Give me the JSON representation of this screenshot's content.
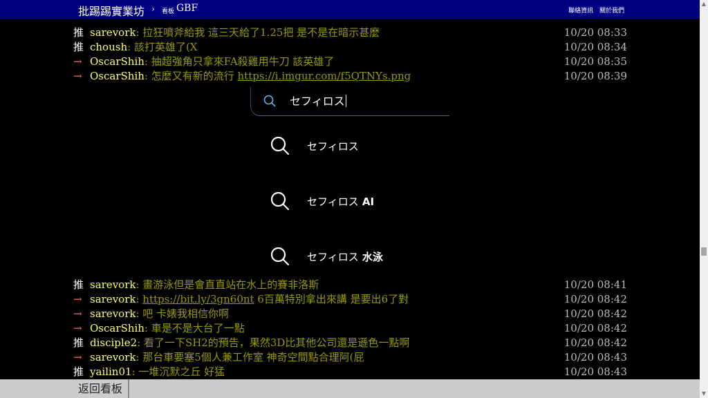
{
  "header": {
    "brand": "批踢踢實業坊",
    "separator": "›",
    "board_label": "看板",
    "board_name": "GBF",
    "links": [
      "聯絡資訊",
      "關於我們"
    ]
  },
  "pushes_top": [
    {
      "tag": "推",
      "user": "sarevork",
      "content": ": 拉狂噴斧給我 這三天給了1.25把 是不是在暗示甚麼",
      "ipdatetime": "10/20 08:33"
    },
    {
      "tag": "推",
      "user": "choush",
      "content": ": 該打英雄了(X",
      "ipdatetime": "10/20 08:34"
    },
    {
      "tag": "→",
      "user": "OscarShih",
      "content": ": 抽超強角只拿來FA殺雞用牛刀 該英雄了",
      "ipdatetime": "10/20 08:35"
    },
    {
      "tag": "→",
      "user": "OscarShih",
      "content_prefix": ": 怎麼又有新的流行 ",
      "link": "https://i.imgur.com/f5QTNYs.png",
      "ipdatetime": "10/20 08:39"
    }
  ],
  "search": {
    "query": "セフィロス",
    "suggestions": [
      {
        "base": "セフィロス",
        "extra": ""
      },
      {
        "base": "セフィロス",
        "extra": " AI"
      },
      {
        "base": "セフィロス",
        "extra": " 水泳"
      }
    ]
  },
  "pushes_bottom": [
    {
      "tag": "推",
      "user": "sarevork",
      "content": ": 畫游泳但是會直直站在水上的賽非洛斯",
      "ipdatetime": "10/20 08:41"
    },
    {
      "tag": "→",
      "user": "sarevork",
      "content_prefix": ": ",
      "link": "https://bit.ly/3gn60nt",
      "content_suffix": " 6百萬特別拿出來講 是要出6了對",
      "ipdatetime": "10/20 08:42"
    },
    {
      "tag": "→",
      "user": "sarevork",
      "content": ": 吧 卡婊我相信你啊",
      "ipdatetime": "10/20 08:42"
    },
    {
      "tag": "→",
      "user": "OscarShih",
      "content": ": 車是不是大台了一點",
      "ipdatetime": "10/20 08:42"
    },
    {
      "tag": "推",
      "user": "disciple2",
      "content": ": 看了一下SH2的預告，果然3D比其他公司還是遜色一點啊",
      "ipdatetime": "10/20 08:42"
    },
    {
      "tag": "→",
      "user": "sarevork",
      "content": ": 那台車要塞5個人兼工作室 神奇空間點合理阿(屁",
      "ipdatetime": "10/20 08:43"
    },
    {
      "tag": "推",
      "user": "yailin01",
      "content": ": 一堆沉默之丘 好猛",
      "ipdatetime": "10/20 08:43"
    }
  ],
  "footer": {
    "back_label": "返回看板"
  }
}
